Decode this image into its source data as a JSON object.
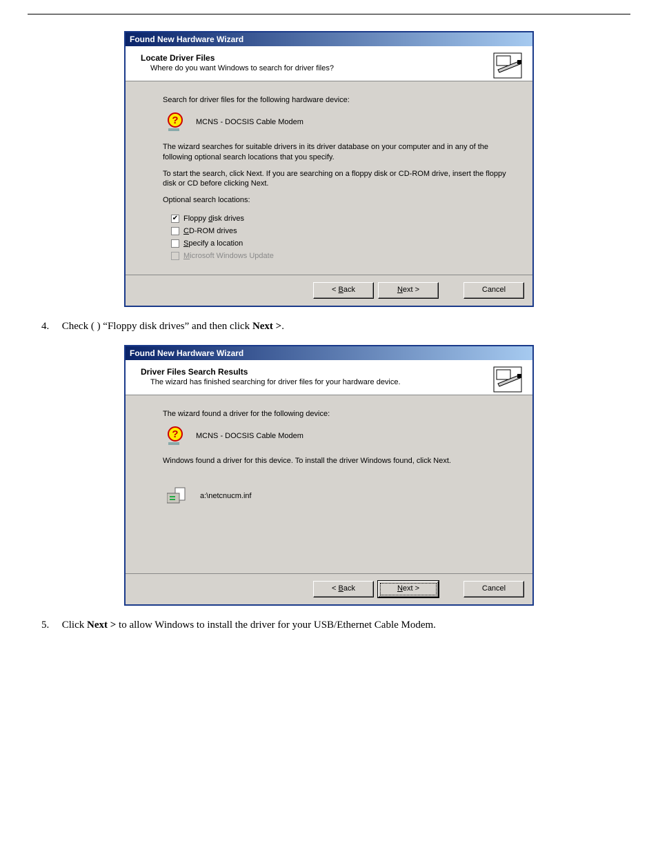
{
  "dialog1": {
    "title": "Found New Hardware Wizard",
    "header_title": "Locate Driver Files",
    "header_sub": "Where do you want Windows to search for driver files?",
    "search_line": "Search for driver files for the following hardware device:",
    "device_name": "MCNS - DOCSIS Cable Modem",
    "para1": "The wizard searches for suitable drivers in its driver database on your computer and in any of the following optional search locations that you specify.",
    "para2": "To start the search, click Next. If you are searching on a floppy disk or CD-ROM drive, insert the floppy disk or CD before clicking Next.",
    "opt_label": "Optional search locations:",
    "options": {
      "floppy": {
        "label_pre": "Floppy ",
        "uline": "d",
        "label_post": "isk drives",
        "checked": true,
        "disabled": false
      },
      "cdrom": {
        "label_pre": "",
        "uline": "C",
        "label_post": "D-ROM drives",
        "checked": false,
        "disabled": false
      },
      "specify": {
        "label_pre": "",
        "uline": "S",
        "label_post": "pecify a location",
        "checked": false,
        "disabled": false
      },
      "wupdate": {
        "label_pre": "",
        "uline": "M",
        "label_post": "icrosoft Windows Update",
        "checked": false,
        "disabled": true
      }
    },
    "buttons": {
      "back_pre": "< ",
      "back_u": "B",
      "back_post": "ack",
      "next_u": "N",
      "next_post": "ext >",
      "cancel": "Cancel"
    }
  },
  "instr4": {
    "num": "4.",
    "text_a": "Check (  ) “Floppy disk drives” and then click ",
    "bold": "Next >",
    "text_b": "."
  },
  "dialog2": {
    "title": "Found New Hardware Wizard",
    "header_title": "Driver Files Search Results",
    "header_sub": "The wizard has finished searching for driver files for your hardware device.",
    "found_line": "The wizard found a driver for the following device:",
    "device_name": "MCNS - DOCSIS Cable Modem",
    "para1": "Windows found a driver for this device. To install the driver Windows found, click Next.",
    "inf_path": "a:\\netcnucm.inf",
    "buttons": {
      "back_pre": "< ",
      "back_u": "B",
      "back_post": "ack",
      "next_u": "N",
      "next_post": "ext >",
      "cancel": "Cancel"
    }
  },
  "instr5": {
    "num": "5.",
    "text_a": "Click ",
    "bold": "Next >",
    "text_b": " to allow Windows to install the driver for your USB/Ethernet Cable Modem."
  }
}
